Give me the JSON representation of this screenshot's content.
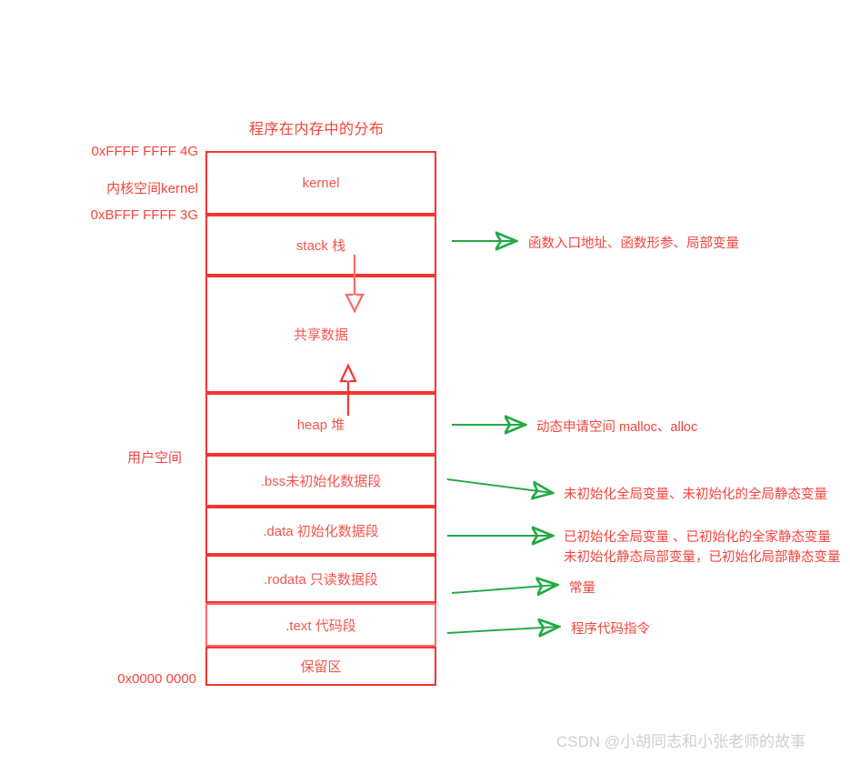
{
  "title": "程序在内存中的分布",
  "left_labels": {
    "addr_top": "0xFFFF FFFF   4G",
    "kernel_space": "内核空间kernel",
    "addr_3g": "0xBFFF FFFF   3G",
    "user_space": "用户空间",
    "addr_bottom": "0x0000 0000"
  },
  "segments": [
    {
      "id": "kernel",
      "label": "kernel"
    },
    {
      "id": "stack",
      "label": "stack 栈"
    },
    {
      "id": "shared",
      "label": "共享数据"
    },
    {
      "id": "heap",
      "label": "heap 堆"
    },
    {
      "id": "bss",
      "label": ".bss未初始化数据段"
    },
    {
      "id": "data",
      "label": ".data 初始化数据段"
    },
    {
      "id": "rodata",
      "label": ".rodata 只读数据段"
    },
    {
      "id": "text",
      "label": ".text 代码段"
    },
    {
      "id": "reserved",
      "label": "保留区"
    }
  ],
  "annotations": [
    {
      "id": "stack-annot",
      "line1": "函数入口地址、函数形参、局部变量",
      "line2": ""
    },
    {
      "id": "heap-annot",
      "line1": "动态申请空间 malloc、alloc",
      "line2": ""
    },
    {
      "id": "bss-annot",
      "line1": "未初始化全局变量、未初始化的全局静态变量",
      "line2": ""
    },
    {
      "id": "data-annot",
      "line1": "已初始化全局变量 、已初始化的全家静态变量",
      "line2": "未初始化静态局部变量，已初始化局部静态变量"
    },
    {
      "id": "rodata-annot",
      "line1": "常量",
      "line2": ""
    },
    {
      "id": "text-annot",
      "line1": "程序代码指令",
      "line2": ""
    }
  ],
  "icons": {
    "stack_growth": "arrow-down-icon",
    "heap_growth": "arrow-up-icon"
  },
  "colors": {
    "box_border": "#f4352f",
    "text_red": "#f4443d",
    "connector_green": "#22aa44",
    "watermark_gray": "#cfcfcf"
  },
  "watermark": "CSDN @小胡同志和小张老师的故事"
}
